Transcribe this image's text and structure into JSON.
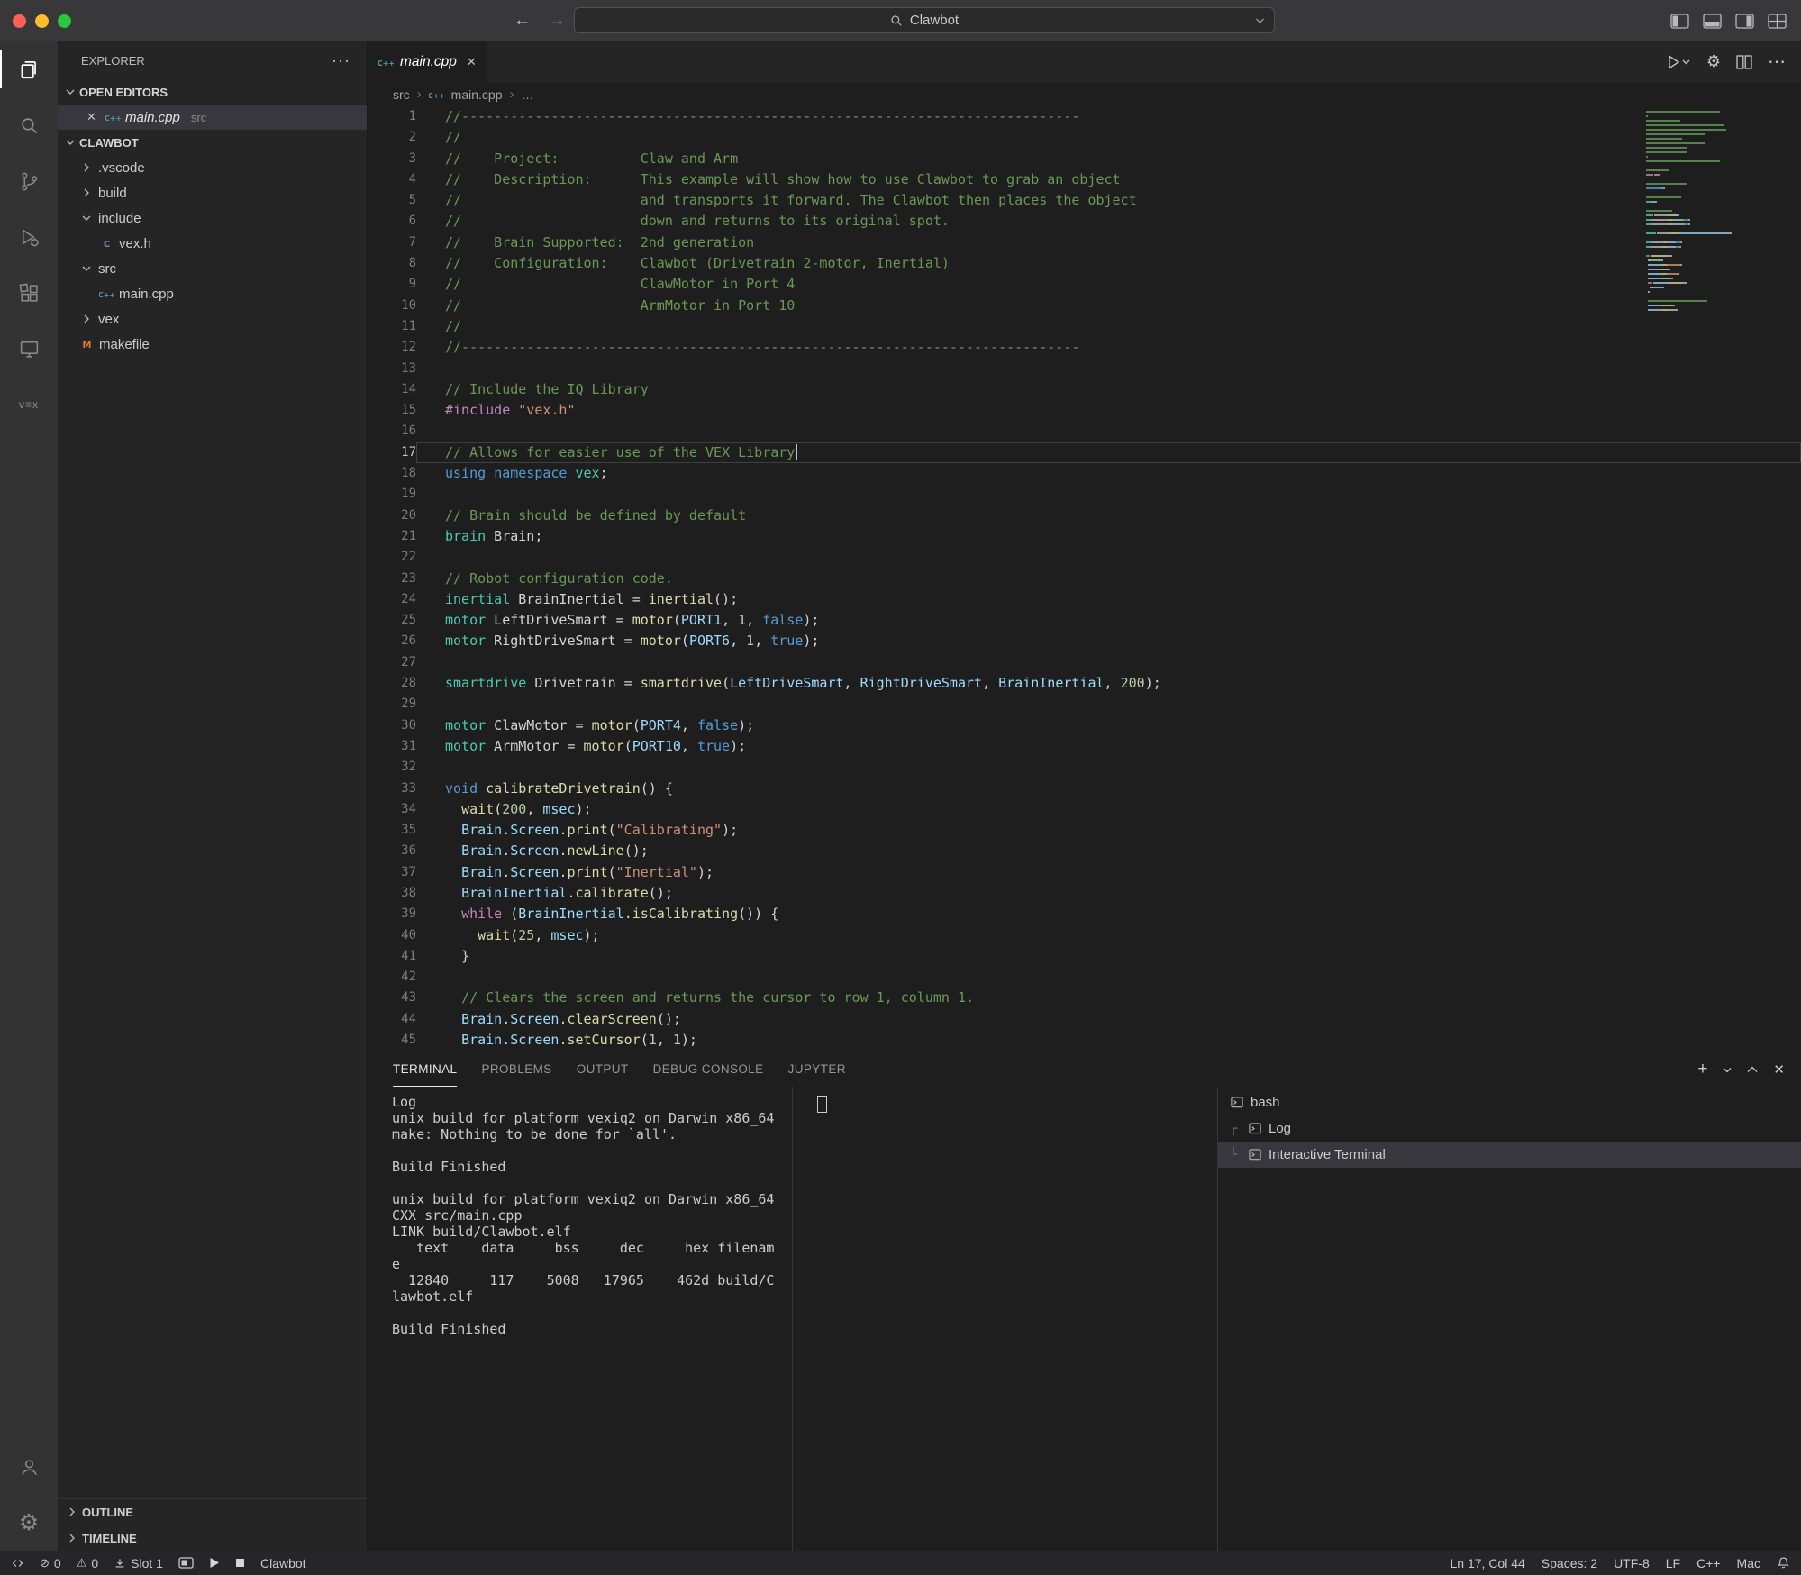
{
  "colors": {
    "traffic_red": "#ff5f57",
    "traffic_yellow": "#febc2e",
    "traffic_green": "#28c840",
    "cpp_icon": "#519aba",
    "header_icon": "#a074c4",
    "makefile_icon": "#e37933"
  },
  "titlebar": {
    "search_label": "Clawbot"
  },
  "activity_bar": {
    "items": [
      {
        "name": "explorer",
        "active": true
      },
      {
        "name": "search"
      },
      {
        "name": "source-control"
      },
      {
        "name": "run-debug"
      },
      {
        "name": "extensions"
      },
      {
        "name": "remote-explorer"
      },
      {
        "name": "vex"
      }
    ],
    "bottom": [
      {
        "name": "accounts"
      },
      {
        "name": "settings"
      }
    ]
  },
  "sidebar": {
    "title": "EXPLORER",
    "open_editors": {
      "header": "OPEN EDITORS",
      "items": [
        {
          "label": "main.cpp",
          "detail": "src",
          "icon": "cpp",
          "selected": true
        }
      ]
    },
    "project": {
      "header": "CLAWBOT",
      "items": [
        {
          "kind": "folder",
          "chevron": "collapsed",
          "label": ".vscode",
          "level": 1
        },
        {
          "kind": "folder",
          "chevron": "collapsed",
          "label": "build",
          "level": 1
        },
        {
          "kind": "folder",
          "chevron": "expanded",
          "label": "include",
          "level": 1
        },
        {
          "kind": "file",
          "icon": "h",
          "label": "vex.h",
          "level": 2
        },
        {
          "kind": "folder",
          "chevron": "expanded",
          "label": "src",
          "level": 1
        },
        {
          "kind": "file",
          "icon": "cpp",
          "label": "main.cpp",
          "level": 2
        },
        {
          "kind": "folder",
          "chevron": "collapsed",
          "label": "vex",
          "level": 1
        },
        {
          "kind": "file",
          "icon": "make",
          "label": "makefile",
          "level": 1
        }
      ]
    },
    "footer_sections": [
      "OUTLINE",
      "TIMELINE"
    ]
  },
  "editor": {
    "tab": {
      "label": "main.cpp",
      "icon": "cpp"
    },
    "breadcrumb": [
      "src",
      "main.cpp",
      "…"
    ],
    "cursor_line": 17,
    "code_lines": [
      {
        "n": 1,
        "s": [
          [
            "c",
            "//----------------------------------------------------------------------------"
          ]
        ]
      },
      {
        "n": 2,
        "s": [
          [
            "c",
            "//"
          ]
        ]
      },
      {
        "n": 3,
        "s": [
          [
            "c",
            "//    Project:          Claw and Arm"
          ]
        ]
      },
      {
        "n": 4,
        "s": [
          [
            "c",
            "//    Description:      This example will show how to use Clawbot to grab an object"
          ]
        ]
      },
      {
        "n": 5,
        "s": [
          [
            "c",
            "//                      and transports it forward. The Clawbot then places the object"
          ]
        ]
      },
      {
        "n": 6,
        "s": [
          [
            "c",
            "//                      down and returns to its original spot."
          ]
        ]
      },
      {
        "n": 7,
        "s": [
          [
            "c",
            "//    Brain Supported:  2nd generation"
          ]
        ]
      },
      {
        "n": 8,
        "s": [
          [
            "c",
            "//    Configuration:    Clawbot (Drivetrain 2-motor, Inertial)"
          ]
        ]
      },
      {
        "n": 9,
        "s": [
          [
            "c",
            "//                      ClawMotor in Port 4"
          ]
        ]
      },
      {
        "n": 10,
        "s": [
          [
            "c",
            "//                      ArmMotor in Port 10"
          ]
        ]
      },
      {
        "n": 11,
        "s": [
          [
            "c",
            "//"
          ]
        ]
      },
      {
        "n": 12,
        "s": [
          [
            "c",
            "//----------------------------------------------------------------------------"
          ]
        ]
      },
      {
        "n": 13,
        "s": []
      },
      {
        "n": 14,
        "s": [
          [
            "c",
            "// Include the IQ Library"
          ]
        ]
      },
      {
        "n": 15,
        "s": [
          [
            "x",
            "#include"
          ],
          [
            "p",
            " "
          ],
          [
            "s",
            "\"vex.h\""
          ]
        ]
      },
      {
        "n": 16,
        "s": []
      },
      {
        "n": 17,
        "s": [
          [
            "c",
            "// Allows for easier use of the VEX Library"
          ]
        ]
      },
      {
        "n": 18,
        "s": [
          [
            "k",
            "using"
          ],
          [
            "p",
            " "
          ],
          [
            "k",
            "namespace"
          ],
          [
            "p",
            " "
          ],
          [
            "t",
            "vex"
          ],
          [
            "p",
            ";"
          ]
        ]
      },
      {
        "n": 19,
        "s": []
      },
      {
        "n": 20,
        "s": [
          [
            "c",
            "// Brain should be defined by default"
          ]
        ]
      },
      {
        "n": 21,
        "s": [
          [
            "t",
            "brain"
          ],
          [
            "p",
            " Brain;"
          ]
        ]
      },
      {
        "n": 22,
        "s": []
      },
      {
        "n": 23,
        "s": [
          [
            "c",
            "// Robot configuration code."
          ]
        ]
      },
      {
        "n": 24,
        "s": [
          [
            "t",
            "inertial"
          ],
          [
            "p",
            " BrainInertial = "
          ],
          [
            "f",
            "inertial"
          ],
          [
            "p",
            "();"
          ]
        ]
      },
      {
        "n": 25,
        "s": [
          [
            "t",
            "motor"
          ],
          [
            "p",
            " LeftDriveSmart = "
          ],
          [
            "f",
            "motor"
          ],
          [
            "p",
            "("
          ],
          [
            "v",
            "PORT1"
          ],
          [
            "p",
            ", "
          ],
          [
            "n2",
            "1"
          ],
          [
            "p",
            ", "
          ],
          [
            "k",
            "false"
          ],
          [
            "p",
            ");"
          ]
        ]
      },
      {
        "n": 26,
        "s": [
          [
            "t",
            "motor"
          ],
          [
            "p",
            " RightDriveSmart = "
          ],
          [
            "f",
            "motor"
          ],
          [
            "p",
            "("
          ],
          [
            "v",
            "PORT6"
          ],
          [
            "p",
            ", "
          ],
          [
            "n2",
            "1"
          ],
          [
            "p",
            ", "
          ],
          [
            "k",
            "true"
          ],
          [
            "p",
            ");"
          ]
        ]
      },
      {
        "n": 27,
        "s": []
      },
      {
        "n": 28,
        "s": [
          [
            "t",
            "smartdrive"
          ],
          [
            "p",
            " Drivetrain = "
          ],
          [
            "f",
            "smartdrive"
          ],
          [
            "p",
            "("
          ],
          [
            "v",
            "LeftDriveSmart"
          ],
          [
            "p",
            ", "
          ],
          [
            "v",
            "RightDriveSmart"
          ],
          [
            "p",
            ", "
          ],
          [
            "v",
            "BrainInertial"
          ],
          [
            "p",
            ", "
          ],
          [
            "n2",
            "200"
          ],
          [
            "p",
            ");"
          ]
        ]
      },
      {
        "n": 29,
        "s": []
      },
      {
        "n": 30,
        "s": [
          [
            "t",
            "motor"
          ],
          [
            "p",
            " ClawMotor = "
          ],
          [
            "f",
            "motor"
          ],
          [
            "p",
            "("
          ],
          [
            "v",
            "PORT4"
          ],
          [
            "p",
            ", "
          ],
          [
            "k",
            "false"
          ],
          [
            "p",
            ");"
          ]
        ]
      },
      {
        "n": 31,
        "s": [
          [
            "t",
            "motor"
          ],
          [
            "p",
            " ArmMotor = "
          ],
          [
            "f",
            "motor"
          ],
          [
            "p",
            "("
          ],
          [
            "v",
            "PORT10"
          ],
          [
            "p",
            ", "
          ],
          [
            "k",
            "true"
          ],
          [
            "p",
            ");"
          ]
        ]
      },
      {
        "n": 32,
        "s": []
      },
      {
        "n": 33,
        "s": [
          [
            "k",
            "void"
          ],
          [
            "p",
            " "
          ],
          [
            "f",
            "calibrateDrivetrain"
          ],
          [
            "p",
            "() {"
          ]
        ]
      },
      {
        "n": 34,
        "s": [
          [
            "p",
            "  "
          ],
          [
            "f",
            "wait"
          ],
          [
            "p",
            "("
          ],
          [
            "n2",
            "200"
          ],
          [
            "p",
            ", "
          ],
          [
            "v",
            "msec"
          ],
          [
            "p",
            ");"
          ]
        ]
      },
      {
        "n": 35,
        "s": [
          [
            "p",
            "  "
          ],
          [
            "v",
            "Brain"
          ],
          [
            "p",
            "."
          ],
          [
            "v",
            "Screen"
          ],
          [
            "p",
            "."
          ],
          [
            "f",
            "print"
          ],
          [
            "p",
            "("
          ],
          [
            "s",
            "\"Calibrating\""
          ],
          [
            "p",
            ");"
          ]
        ]
      },
      {
        "n": 36,
        "s": [
          [
            "p",
            "  "
          ],
          [
            "v",
            "Brain"
          ],
          [
            "p",
            "."
          ],
          [
            "v",
            "Screen"
          ],
          [
            "p",
            "."
          ],
          [
            "f",
            "newLine"
          ],
          [
            "p",
            "();"
          ]
        ]
      },
      {
        "n": 37,
        "s": [
          [
            "p",
            "  "
          ],
          [
            "v",
            "Brain"
          ],
          [
            "p",
            "."
          ],
          [
            "v",
            "Screen"
          ],
          [
            "p",
            "."
          ],
          [
            "f",
            "print"
          ],
          [
            "p",
            "("
          ],
          [
            "s",
            "\"Inertial\""
          ],
          [
            "p",
            ");"
          ]
        ]
      },
      {
        "n": 38,
        "s": [
          [
            "p",
            "  "
          ],
          [
            "v",
            "BrainInertial"
          ],
          [
            "p",
            "."
          ],
          [
            "f",
            "calibrate"
          ],
          [
            "p",
            "();"
          ]
        ]
      },
      {
        "n": 39,
        "s": [
          [
            "p",
            "  "
          ],
          [
            "x",
            "while"
          ],
          [
            "p",
            " ("
          ],
          [
            "v",
            "BrainInertial"
          ],
          [
            "p",
            "."
          ],
          [
            "f",
            "isCalibrating"
          ],
          [
            "p",
            "()) {"
          ]
        ]
      },
      {
        "n": 40,
        "s": [
          [
            "p",
            "    "
          ],
          [
            "f",
            "wait"
          ],
          [
            "p",
            "("
          ],
          [
            "n2",
            "25"
          ],
          [
            "p",
            ", "
          ],
          [
            "v",
            "msec"
          ],
          [
            "p",
            ");"
          ]
        ]
      },
      {
        "n": 41,
        "s": [
          [
            "p",
            "  }"
          ]
        ]
      },
      {
        "n": 42,
        "s": []
      },
      {
        "n": 43,
        "s": [
          [
            "p",
            "  "
          ],
          [
            "c",
            "// Clears the screen and returns the cursor to row 1, column 1."
          ]
        ]
      },
      {
        "n": 44,
        "s": [
          [
            "p",
            "  "
          ],
          [
            "v",
            "Brain"
          ],
          [
            "p",
            "."
          ],
          [
            "v",
            "Screen"
          ],
          [
            "p",
            "."
          ],
          [
            "f",
            "clearScreen"
          ],
          [
            "p",
            "();"
          ]
        ]
      },
      {
        "n": 45,
        "s": [
          [
            "p",
            "  "
          ],
          [
            "v",
            "Brain"
          ],
          [
            "p",
            "."
          ],
          [
            "v",
            "Screen"
          ],
          [
            "p",
            "."
          ],
          [
            "f",
            "setCursor"
          ],
          [
            "p",
            "("
          ],
          [
            "n2",
            "1"
          ],
          [
            "p",
            ", "
          ],
          [
            "n2",
            "1"
          ],
          [
            "p",
            ");"
          ]
        ]
      }
    ]
  },
  "panel": {
    "tabs": [
      {
        "label": "TERMINAL",
        "active": true
      },
      {
        "label": "PROBLEMS"
      },
      {
        "label": "OUTPUT"
      },
      {
        "label": "DEBUG CONSOLE"
      },
      {
        "label": "JUPYTER"
      }
    ],
    "terminal_output": [
      "Log",
      "unix build for platform vexiq2 on Darwin x86_64",
      "make: Nothing to be done for `all'.",
      "",
      "Build Finished",
      "",
      "unix build for platform vexiq2 on Darwin x86_64",
      "CXX src/main.cpp",
      "LINK build/Clawbot.elf",
      "   text    data     bss     dec     hex filenam",
      "e",
      "  12840     117    5008   17965    462d build/C",
      "lawbot.elf",
      "",
      "Build Finished"
    ],
    "terminal_list": [
      {
        "label": "bash",
        "level": 0
      },
      {
        "label": "Log",
        "level": 1,
        "guide": "┌"
      },
      {
        "label": "Interactive Terminal",
        "level": 1,
        "guide": "└",
        "selected": true
      }
    ]
  },
  "status_bar": {
    "left": [
      {
        "name": "remote-indicator",
        "icon": "remote"
      },
      {
        "name": "problems-errors",
        "icon": "error",
        "text": "0"
      },
      {
        "name": "problems-warnings",
        "icon": "warning",
        "text": "0"
      },
      {
        "name": "vex-slot",
        "icon": "slot",
        "text": "Slot 1"
      },
      {
        "name": "vex-brain",
        "icon": "brain"
      },
      {
        "name": "vex-run",
        "icon": "play"
      },
      {
        "name": "vex-stop",
        "icon": "stop"
      },
      {
        "name": "project-name",
        "text": "Clawbot"
      }
    ],
    "right": [
      {
        "name": "cursor-position",
        "text": "Ln 17, Col 44"
      },
      {
        "name": "indentation",
        "text": "Spaces: 2"
      },
      {
        "name": "encoding",
        "text": "UTF-8"
      },
      {
        "name": "eol",
        "text": "LF"
      },
      {
        "name": "language-mode",
        "text": "C++"
      },
      {
        "name": "keymap",
        "text": "Mac"
      },
      {
        "name": "notifications",
        "icon": "bell"
      }
    ]
  }
}
